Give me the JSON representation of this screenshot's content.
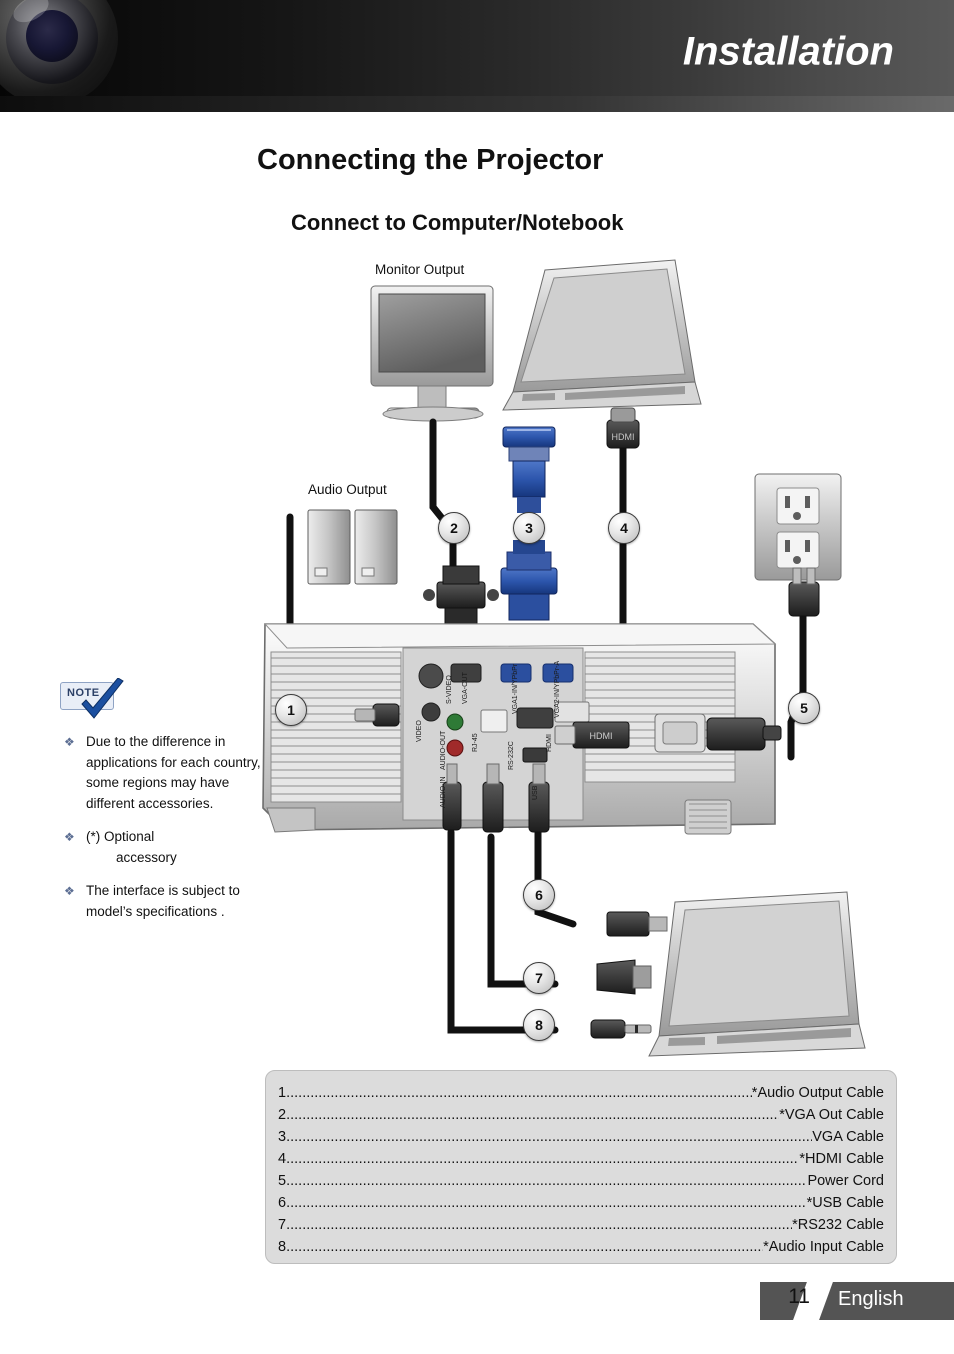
{
  "header": {
    "title": "Installation"
  },
  "page": {
    "title": "Connecting the Projector",
    "subtitle": "Connect to Computer/Notebook"
  },
  "note": {
    "badge": "NOTE",
    "items": [
      "Due to the difference in applications for each country, some regions may have different accessories.",
      "(*) Optional accessory",
      "The interface is subject to model’s specifications ."
    ],
    "item2_main": "(*) Optional",
    "item2_indent": "accessory",
    "bullet": "❖"
  },
  "diagram": {
    "labels": {
      "monitor_output": "Monitor Output",
      "audio_output": "Audio Output"
    },
    "callouts": [
      "1",
      "2",
      "3",
      "4",
      "5",
      "6",
      "7",
      "8"
    ],
    "projector_ports": [
      "S-VIDEO",
      "VIDEO",
      "VGA-OUT",
      "VGA1-IN/YPbPr",
      "VGA2-IN/YPbPr-A",
      "AUDIO-OUT",
      "RJ-45",
      "AUDIO-IN",
      "RS-232C",
      "HDMI",
      "USB"
    ]
  },
  "legend": {
    "rows": [
      {
        "num": "1",
        "value": "*Audio Output Cable"
      },
      {
        "num": "2",
        "value": "*VGA Out Cable"
      },
      {
        "num": "3",
        "value": "VGA Cable"
      },
      {
        "num": "4",
        "value": "*HDMI Cable"
      },
      {
        "num": "5",
        "value": "Power Cord"
      },
      {
        "num": "6",
        "value": "*USB Cable"
      },
      {
        "num": "7",
        "value": "*RS232 Cable"
      },
      {
        "num": "8",
        "value": "*Audio Input Cable"
      }
    ],
    "dots": "................................................................................................................................................"
  },
  "footer": {
    "page_number": "11",
    "language": "English"
  }
}
